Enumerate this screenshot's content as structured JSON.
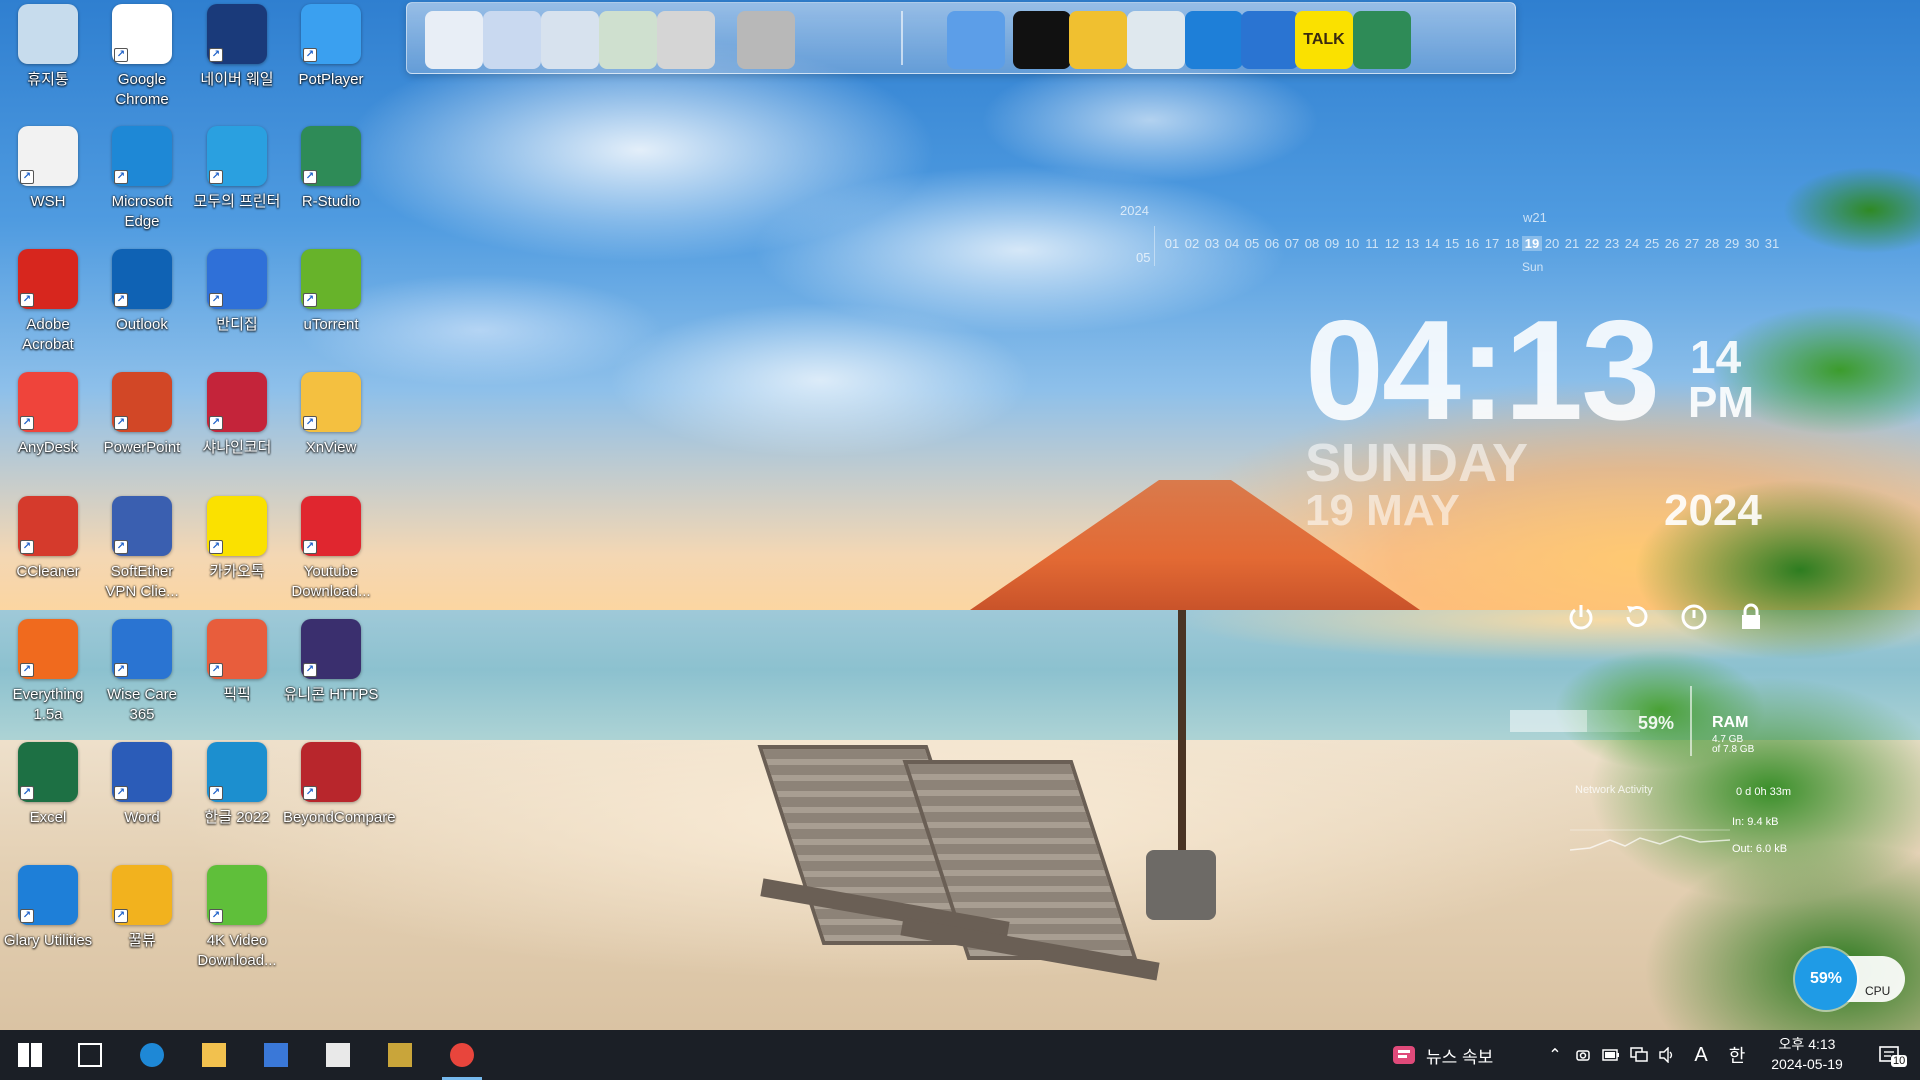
{
  "desktop": {
    "icons": [
      {
        "label": "휴지통",
        "icon": "recycle-bin-icon",
        "color": "#c7dced"
      },
      {
        "label": "Google Chrome",
        "icon": "chrome-icon",
        "color": "#ffffff"
      },
      {
        "label": "네이버 웨일",
        "icon": "naver-whale-icon",
        "color": "#1a3a7a"
      },
      {
        "label": "PotPlayer",
        "icon": "potplayer-icon",
        "color": "#3aa0f0"
      },
      {
        "label": "WSH",
        "icon": "wsh-file-icon",
        "color": "#f2f2f2"
      },
      {
        "label": "Microsoft Edge",
        "icon": "edge-icon",
        "color": "#1e88d6"
      },
      {
        "label": "모두의 프린터",
        "icon": "printer-icon",
        "color": "#2aa0e0"
      },
      {
        "label": "R-Studio",
        "icon": "r-studio-icon",
        "color": "#2e8b57"
      },
      {
        "label": "Adobe Acrobat",
        "icon": "acrobat-icon",
        "color": "#d7261e"
      },
      {
        "label": "Outlook",
        "icon": "outlook-icon",
        "color": "#0f62b4"
      },
      {
        "label": "반디집",
        "icon": "bandizip-icon",
        "color": "#2f70d8"
      },
      {
        "label": "uTorrent",
        "icon": "utorrent-icon",
        "color": "#67b32a"
      },
      {
        "label": "AnyDesk",
        "icon": "anydesk-icon",
        "color": "#ef443b"
      },
      {
        "label": "PowerPoint",
        "icon": "powerpoint-icon",
        "color": "#d24726"
      },
      {
        "label": "샤나인코더",
        "icon": "shana-encoder-icon",
        "color": "#c4243a"
      },
      {
        "label": "XnView",
        "icon": "xnview-icon",
        "color": "#f4c040"
      },
      {
        "label": "CCleaner",
        "icon": "ccleaner-icon",
        "color": "#d53a2c"
      },
      {
        "label": "SoftEther VPN Clie...",
        "icon": "softether-vpn-icon",
        "color": "#3a5fb0"
      },
      {
        "label": "카카오톡",
        "icon": "kakaotalk-icon",
        "color": "#fae100"
      },
      {
        "label": "Youtube Download...",
        "icon": "youtube-downloader-icon",
        "color": "#e0262f"
      },
      {
        "label": "Everything 1.5a",
        "icon": "everything-search-icon",
        "color": "#f06a1e"
      },
      {
        "label": "Wise Care 365",
        "icon": "wise-care-icon",
        "color": "#2a74d2"
      },
      {
        "label": "픽픽",
        "icon": "picpick-icon",
        "color": "#e85d3c"
      },
      {
        "label": "유니콘 HTTPS",
        "icon": "unicorn-https-icon",
        "color": "#3a2f6e"
      },
      {
        "label": "Excel",
        "icon": "excel-icon",
        "color": "#1d7044"
      },
      {
        "label": "Word",
        "icon": "word-icon",
        "color": "#2b5cb8"
      },
      {
        "label": "한글 2022",
        "icon": "hangul-icon",
        "color": "#1c8fcf"
      },
      {
        "label": "BeyondCompare",
        "icon": "beyondcompare-icon",
        "color": "#b8262c"
      },
      {
        "label": "Glary Utilities",
        "icon": "glary-utilities-icon",
        "color": "#1e7fd8"
      },
      {
        "label": "꿀뷰",
        "icon": "honeyview-icon",
        "color": "#f2b21e"
      },
      {
        "label": "4K Video Download...",
        "icon": "4k-video-downloader-icon",
        "color": "#5fbf3a"
      }
    ]
  },
  "dock": {
    "items": [
      {
        "icon": "computer-icon",
        "color": "#e8eef6"
      },
      {
        "icon": "network-icon",
        "color": "#c9d9f0"
      },
      {
        "icon": "folder-icon",
        "color": "#d7e2ee"
      },
      {
        "icon": "downloads-folder-icon",
        "color": "#cfe0cf"
      },
      {
        "icon": "pictures-folder-icon",
        "color": "#d5d5d5"
      },
      {
        "icon": "tools-icon",
        "color": "#b8b8b8"
      },
      {
        "icon": "globe-icon",
        "color": "#5c9ee8"
      },
      {
        "icon": "tshirt-icon",
        "color": "#111111"
      },
      {
        "icon": "hammer-icon",
        "color": "#f0c030"
      },
      {
        "icon": "recycle-icon",
        "color": "#dfe8ee"
      },
      {
        "icon": "glary-icon",
        "color": "#1e7fd8"
      },
      {
        "icon": "wise-icon",
        "color": "#2a74d2"
      },
      {
        "icon": "kakaotalk-icon",
        "color": "#fae100",
        "label": "TALK"
      },
      {
        "icon": "r-studio-icon",
        "color": "#2e8b57"
      }
    ]
  },
  "calendar": {
    "year": "2024",
    "week": "w21",
    "month": "05",
    "days": [
      "01",
      "02",
      "03",
      "04",
      "05",
      "06",
      "07",
      "08",
      "09",
      "10",
      "11",
      "12",
      "13",
      "14",
      "15",
      "16",
      "17",
      "18",
      "19",
      "20",
      "21",
      "22",
      "23",
      "24",
      "25",
      "26",
      "27",
      "28",
      "29",
      "30",
      "31"
    ],
    "today_index": 18,
    "today_name": "Sun"
  },
  "clock": {
    "time": "04:13",
    "seconds": "14",
    "ampm": "PM",
    "day": "SUNDAY",
    "date": "19 MAY",
    "year": "2024"
  },
  "power": [
    {
      "icon": "power-icon"
    },
    {
      "icon": "restart-icon"
    },
    {
      "icon": "logoff-icon"
    },
    {
      "icon": "lock-icon"
    }
  ],
  "sysmon": {
    "ram_pct": "59%",
    "ram_fraction": 0.59,
    "ram_title": "RAM",
    "ram_used": "4.7 GB",
    "ram_total": "of 7.8 GB",
    "net_title": "Network Activity",
    "uptime": "0 d 0h 33m",
    "net_in": "In: 9.4 kB",
    "net_out": "Out: 6.0 kB"
  },
  "cpu": {
    "pct": "59%",
    "label": "CPU"
  },
  "taskbar": {
    "buttons": [
      {
        "icon": "windows-start-icon"
      },
      {
        "icon": "task-view-icon"
      },
      {
        "icon": "edge-icon"
      },
      {
        "icon": "file-explorer-icon"
      },
      {
        "icon": "microsoft-store-icon"
      },
      {
        "icon": "mail-icon"
      },
      {
        "icon": "r-app-icon"
      },
      {
        "icon": "chrome-icon"
      }
    ],
    "news": "뉴스 속보",
    "ime_mode": "A",
    "ime_lang": "한",
    "clock_time": "오후 4:13",
    "clock_date": "2024-05-19",
    "notification_count": "10"
  }
}
